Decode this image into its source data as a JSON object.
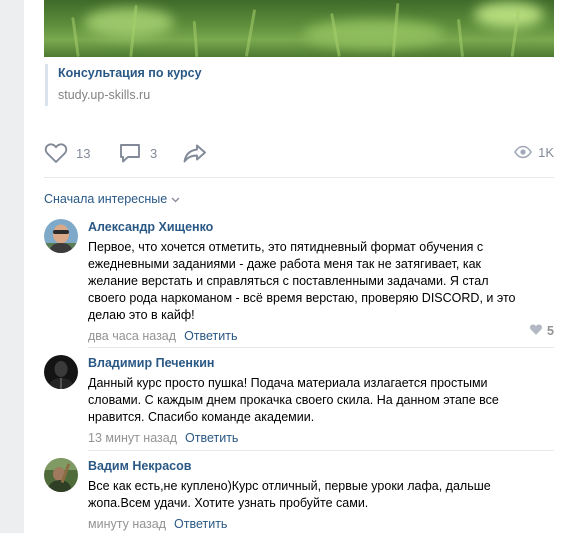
{
  "attachment": {
    "title": "Консультация по курсу",
    "url": "study.up-skills.ru"
  },
  "actions": {
    "likes": "13",
    "comments": "3",
    "views": "1K"
  },
  "sort": {
    "label": "Сначала интересные"
  },
  "comments": [
    {
      "author": "Александр Хищенко",
      "text": "Первое, что хочется отметить, это пятидневный формат обучения с\nежедневными заданиями - даже работа меня так не затягивает, как\nжелание верстать и справляться с поставленными задачами. Я стал\nсвоего рода наркоманом - всё время верстаю, проверяю DISCORD, и это\nделаю это в кайф!",
      "time": "два часа назад",
      "reply": "Ответить",
      "likes": "5"
    },
    {
      "author": "Владимир Печенкин",
      "text": "Данный курс просто пушка! Подача материала излагается простыми\nсловами. С каждым днем прокачка своего скила. На данном этапе все\nнравится. Спасибо команде академии.",
      "time": "13 минут назад",
      "reply": "Ответить"
    },
    {
      "author": "Вадим Некрасов",
      "text": "Все как есть,не куплено)Курс отличный, первые уроки лафа, дальше\nжопа.Всем удачи. Хотите узнать пробуйте сами.",
      "time": "минуту назад",
      "reply": "Ответить"
    }
  ],
  "colors": {
    "link": "#2a5885",
    "muted": "#828a99",
    "page_bg": "#edeef0",
    "card_bg": "#ffffff"
  }
}
